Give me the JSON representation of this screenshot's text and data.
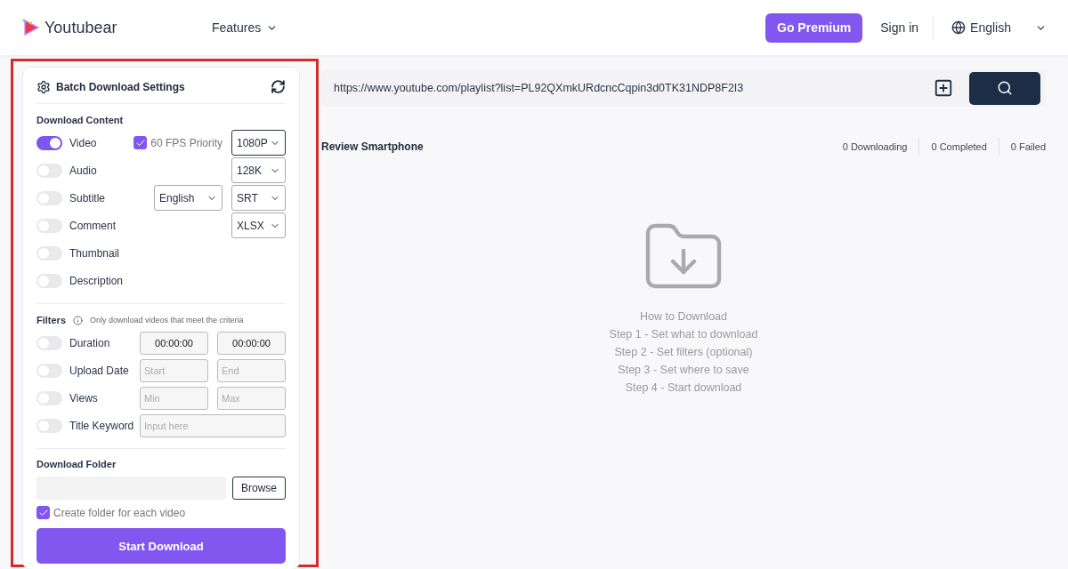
{
  "header": {
    "logo": "Youtubear",
    "nav": "Features",
    "premium": "Go Premium",
    "signin": "Sign in",
    "language": "English"
  },
  "settings": {
    "title": "Batch Download Settings",
    "content_heading": "Download Content",
    "content": [
      {
        "label": "Video",
        "on": true,
        "fps": {
          "label": "60 FPS Priority",
          "checked": true
        },
        "selects": [
          {
            "value": "1080P",
            "focused": true
          }
        ]
      },
      {
        "label": "Audio",
        "on": false,
        "selects": [
          {
            "value": "128K",
            "focused": false
          }
        ]
      },
      {
        "label": "Subtitle",
        "on": false,
        "selects": [
          {
            "value": "English",
            "focused": false
          },
          {
            "value": "SRT",
            "focused": false
          }
        ]
      },
      {
        "label": "Comment",
        "on": false,
        "selects": [
          {
            "value": "XLSX",
            "focused": false
          }
        ]
      },
      {
        "label": "Thumbnail",
        "on": false
      },
      {
        "label": "Description",
        "on": false
      }
    ],
    "filters_heading": "Filters",
    "filters_note": "Only download videos that meet the criteria",
    "filters": [
      {
        "label": "Duration",
        "on": false,
        "inputs": [
          {
            "value": "00:00:00"
          },
          {
            "value": "00:00:00"
          }
        ]
      },
      {
        "label": "Upload Date",
        "on": false,
        "inputs": [
          {
            "placeholder": "Start"
          },
          {
            "placeholder": "End"
          }
        ]
      },
      {
        "label": "Views",
        "on": false,
        "inputs": [
          {
            "placeholder": "Min"
          },
          {
            "placeholder": "Max"
          }
        ]
      },
      {
        "label": "Title Keyword",
        "on": false,
        "inputs": [
          {
            "placeholder": "Input here"
          }
        ]
      }
    ],
    "folder_heading": "Download Folder",
    "browse": "Browse",
    "create_folder": {
      "label": "Create folder for each video",
      "checked": true
    },
    "start": "Start Download"
  },
  "main": {
    "url": "https://www.youtube.com/playlist?list=PL92QXmkURdcncCqpin3d0TK31NDP8F2I3",
    "playlist_title": "Review Smartphone",
    "stats": [
      "0 Downloading",
      "0 Completed",
      "0 Failed"
    ],
    "empty_state": [
      "How to Download",
      "Step 1 - Set what to download",
      "Step 2 - Set filters (optional)",
      "Step 3 - Set where to save",
      "Step 4 - Start download"
    ]
  }
}
